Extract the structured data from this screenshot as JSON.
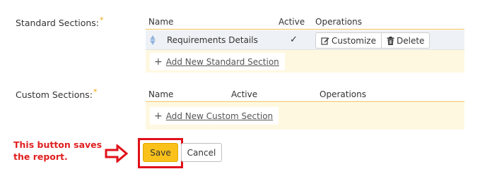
{
  "standard_sections": {
    "label": "Standard Sections:",
    "required_mark": "*",
    "columns": {
      "name": "Name",
      "active": "Active",
      "operations": "Operations"
    },
    "rows": [
      {
        "name": "Requirements Details",
        "active": "✓",
        "customize_label": "Customize",
        "delete_label": "Delete"
      }
    ],
    "add_label": "Add New Standard Section"
  },
  "custom_sections": {
    "label": "Custom Sections:",
    "required_mark": "*",
    "columns": {
      "name": "Name",
      "active": "Active",
      "operations": "Operations"
    },
    "add_label": "Add New Custom Section"
  },
  "annotation": {
    "text": "This button saves the report."
  },
  "actions": {
    "save_label": "Save",
    "cancel_label": "Cancel"
  },
  "colors": {
    "accent": "#f9c11a",
    "panel_bg": "#fff8e1",
    "annotation_red": "#e0101a"
  }
}
